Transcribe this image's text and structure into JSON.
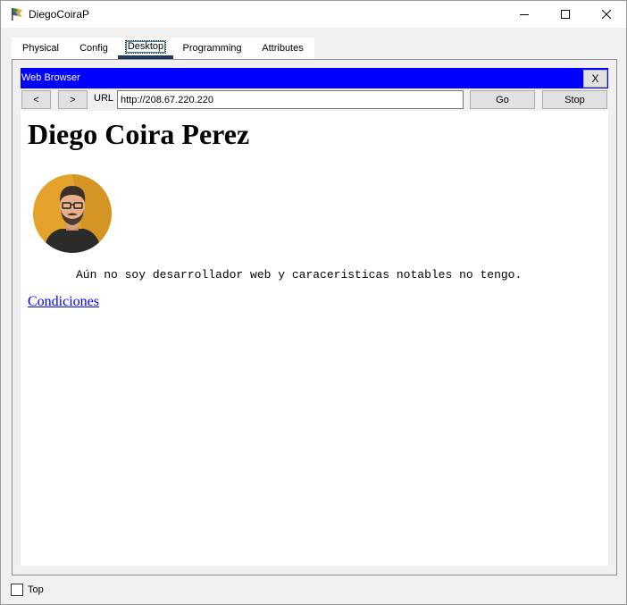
{
  "window": {
    "title": "DiegoCoiraP",
    "tabs": [
      {
        "label": "Physical",
        "active": false
      },
      {
        "label": "Config",
        "active": false
      },
      {
        "label": "Desktop",
        "active": true
      },
      {
        "label": "Programming",
        "active": false
      },
      {
        "label": "Attributes",
        "active": false
      }
    ]
  },
  "browser": {
    "title": "Web Browser",
    "close_label": "X",
    "back_label": "<",
    "forward_label": ">",
    "url_label": "URL",
    "url_value": "http://208.67.220.220",
    "go_label": "Go",
    "stop_label": "Stop",
    "title_bar_color": "#0000ff"
  },
  "page": {
    "heading": "Diego Coira Perez",
    "description": "Aún no soy desarrollador web y caraceristicas notables no tengo.",
    "link_text": "Condiciones",
    "avatar_icon": "person-avatar-icon"
  },
  "footer": {
    "top_label": "Top",
    "top_checked": false
  }
}
